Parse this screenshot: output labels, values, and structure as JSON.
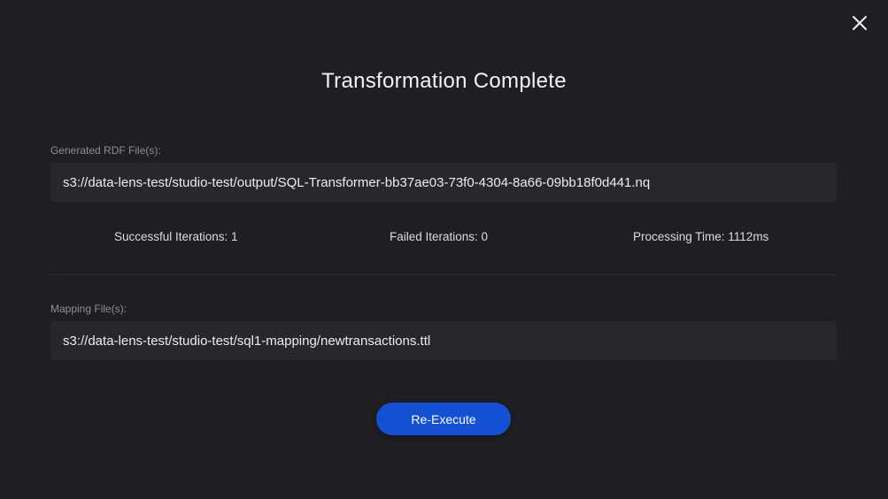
{
  "dialog": {
    "title": "Transformation Complete",
    "close_icon": "close-icon"
  },
  "generated": {
    "label": "Generated RDF File(s):",
    "value": "s3://data-lens-test/studio-test/output/SQL-Transformer-bb37ae03-73f0-4304-8a66-09bb18f0d441.nq"
  },
  "stats": {
    "successful": "Successful Iterations: 1",
    "failed": "Failed Iterations: 0",
    "processing_time": "Processing Time: 1112ms"
  },
  "mapping": {
    "label": "Mapping File(s):",
    "value": "s3://data-lens-test/studio-test/sql1-mapping/newtransactions.ttl"
  },
  "actions": {
    "re_execute_label": "Re-Execute"
  },
  "colors": {
    "background": "#1f1f22",
    "field_background": "#28282c",
    "accent": "#1450d4"
  }
}
